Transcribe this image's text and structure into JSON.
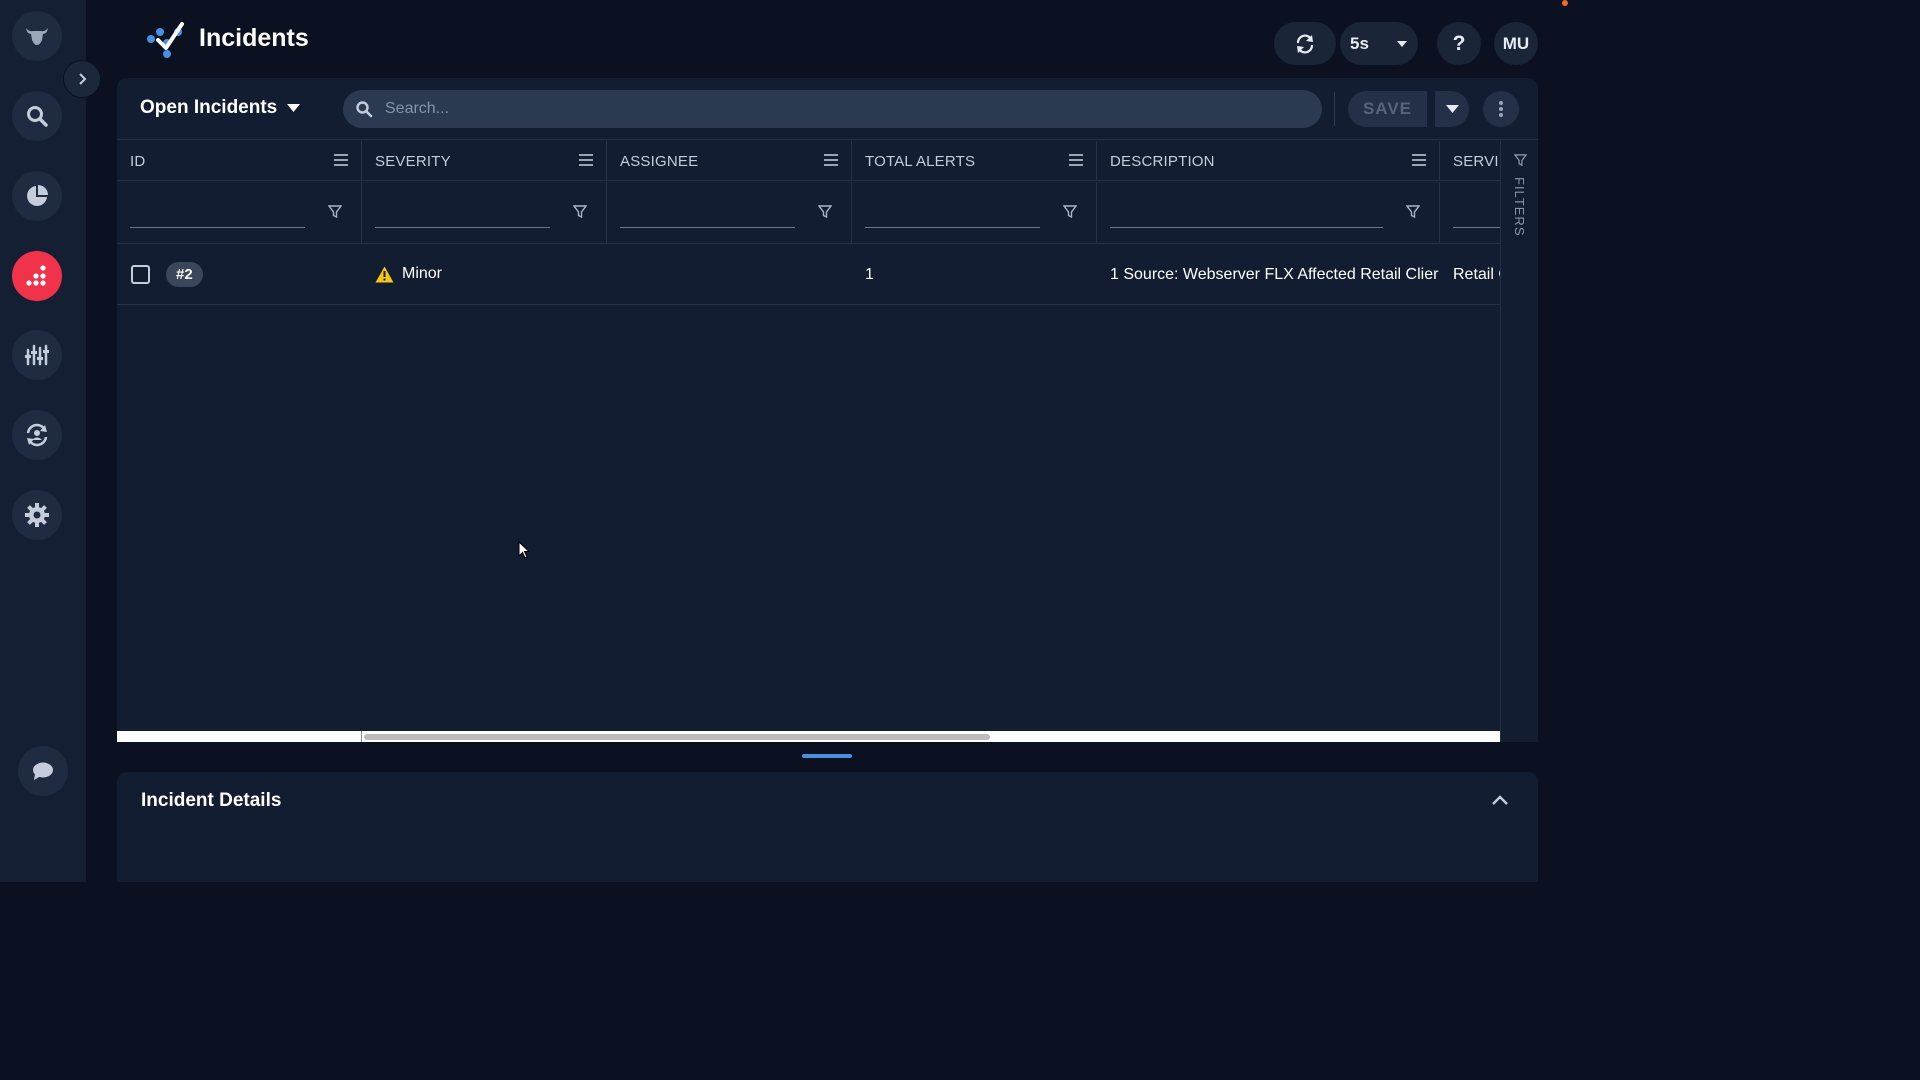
{
  "header": {
    "title": "Incidents",
    "refresh_interval": "5s",
    "help_label": "?",
    "user_initials": "MU"
  },
  "toolbar": {
    "view_name": "Open Incidents",
    "search_placeholder": "Search...",
    "save_label": "SAVE"
  },
  "table": {
    "columns": [
      "ID",
      "SEVERITY",
      "ASSIGNEE",
      "TOTAL ALERTS",
      "DESCRIPTION",
      "SERVI"
    ],
    "rows": [
      {
        "id": "#2",
        "severity": "Minor",
        "assignee": "",
        "total_alerts": "1",
        "description": "1 Source: Webserver FLX Affected Retail Clier",
        "service": "Retail C"
      }
    ]
  },
  "filters_label": "FILTERS",
  "details": {
    "title": "Incident Details"
  },
  "colors": {
    "accent": "#4a90e2",
    "active_nav": "#f0334b",
    "warning": "#f5c518",
    "background": "#0b1120",
    "panel": "#121d31"
  },
  "icons": {
    "rail": [
      "bull-logo-icon",
      "search-icon",
      "pie-chart-icon",
      "incidents-icon",
      "sliders-icon",
      "sync-icon",
      "gear-icon",
      "chat-icon"
    ],
    "header": [
      "refresh-icon",
      "chevron-down-icon",
      "help-icon"
    ]
  }
}
